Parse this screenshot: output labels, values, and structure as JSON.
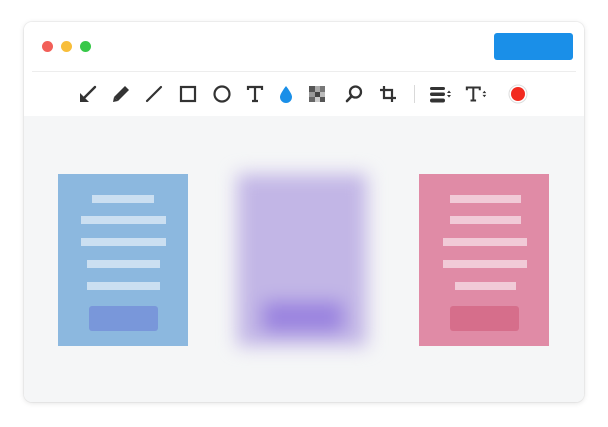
{
  "window": {
    "controls": [
      "close",
      "minimize",
      "maximize"
    ],
    "primary_button_color": "#1a8fe8"
  },
  "toolbar": {
    "tools": [
      {
        "name": "arrow-tool",
        "icon": "arrow-down-left-icon"
      },
      {
        "name": "pen-tool",
        "icon": "pencil-icon"
      },
      {
        "name": "line-tool",
        "icon": "line-icon"
      },
      {
        "name": "rectangle-tool",
        "icon": "square-icon"
      },
      {
        "name": "ellipse-tool",
        "icon": "circle-icon"
      },
      {
        "name": "text-tool",
        "icon": "text-t-icon"
      },
      {
        "name": "blur-tool",
        "icon": "droplet-icon",
        "active": true
      },
      {
        "name": "pixelate-tool",
        "icon": "mosaic-icon"
      },
      {
        "name": "magnifier-tool",
        "icon": "magnifier-icon"
      },
      {
        "name": "crop-tool",
        "icon": "crop-icon"
      },
      {
        "name": "stroke-width-select",
        "icon": "line-width-icon"
      },
      {
        "name": "font-size-select",
        "icon": "text-size-icon"
      },
      {
        "name": "color-picker",
        "icon": "color-dot-icon",
        "color": "#f22a1f"
      }
    ],
    "active_tool_color": "#1a8fe8",
    "icon_color": "#333333"
  },
  "canvas": {
    "background": "#f5f6f7",
    "cards": [
      {
        "name": "blue-card",
        "color": "#8cb8df",
        "button_color": "#7997da",
        "blurred": false
      },
      {
        "name": "purple-card",
        "color": "#c2b6e6",
        "button_color": "#9a83df",
        "blurred": true
      },
      {
        "name": "pink-card",
        "color": "#e08ba6",
        "button_color": "#d66e8b",
        "blurred": false
      }
    ]
  }
}
